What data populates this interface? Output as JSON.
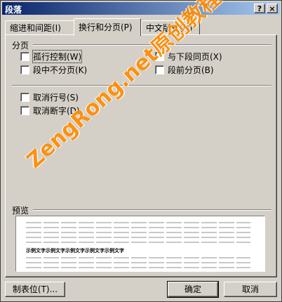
{
  "window": {
    "title": "段落",
    "help_btn": "?",
    "close_btn": "×"
  },
  "tabs": [
    {
      "label": "缩进和间距(I)"
    },
    {
      "label": "换行和分页(P)"
    },
    {
      "label": "中文版式(H)"
    }
  ],
  "pagination": {
    "group_label": "分页",
    "options": [
      {
        "label": "孤行控制(W)",
        "checked": false
      },
      {
        "label": "与下段同页(X)",
        "checked": false
      },
      {
        "label": "段中不分页(K)",
        "checked": false
      },
      {
        "label": "段前分页(B)",
        "checked": false
      }
    ]
  },
  "other": {
    "options": [
      {
        "label": "取消行号(S)",
        "checked": false
      },
      {
        "label": "取消断字(D)",
        "checked": false
      }
    ]
  },
  "preview": {
    "label": "预览",
    "sample_text": "示例文字示例文字示例文字示例文字示例文字"
  },
  "buttons": {
    "tabs_label": "制表位(T)...",
    "ok_label": "确定",
    "cancel_label": "取消"
  },
  "watermark": "ZengRong.net原创教程"
}
